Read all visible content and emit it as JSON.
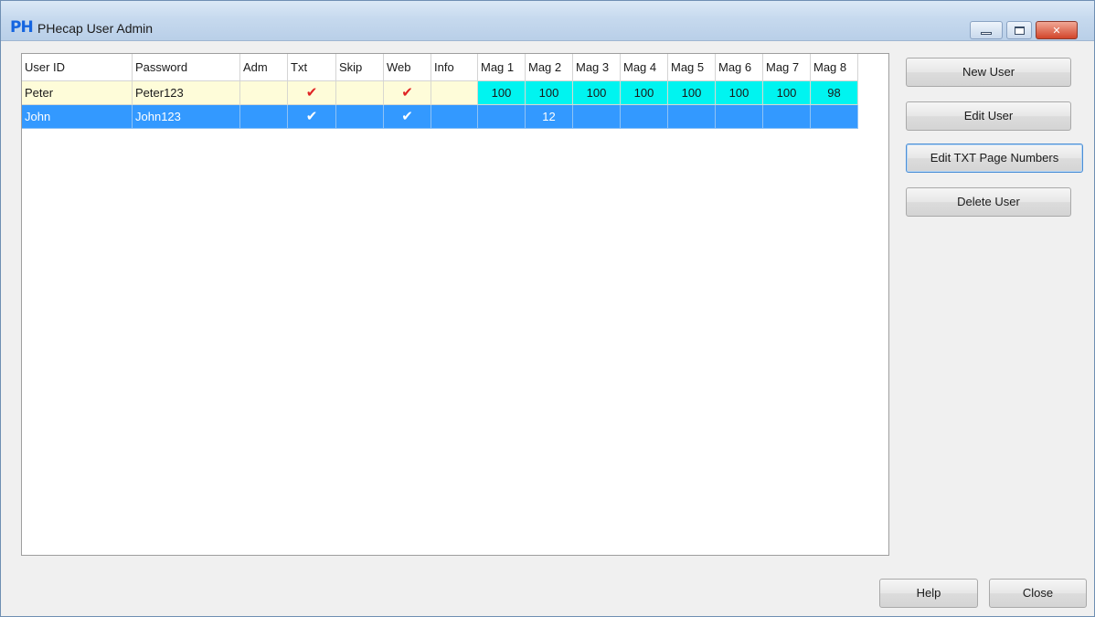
{
  "window": {
    "title": "PHecap User Admin",
    "icon_text": "PH",
    "controls": {
      "minimize": "minimize-icon",
      "maximize": "maximize-icon",
      "close": "close-icon",
      "close_glyph": "✕"
    }
  },
  "table": {
    "columns": [
      "User ID",
      "Password",
      "Adm",
      "Txt",
      "Skip",
      "Web",
      "Info",
      "Mag 1",
      "Mag 2",
      "Mag 3",
      "Mag 4",
      "Mag 5",
      "Mag 6",
      "Mag 7",
      "Mag 8"
    ],
    "check_glyph": "✔",
    "rows": [
      {
        "user_id": "Peter",
        "password": "Peter123",
        "adm": "",
        "txt": "✔",
        "skip": "",
        "web": "✔",
        "info": "",
        "mags": [
          "100",
          "100",
          "100",
          "100",
          "100",
          "100",
          "100",
          "98"
        ]
      },
      {
        "user_id": "John",
        "password": "John123",
        "adm": "",
        "txt": "✔",
        "skip": "",
        "web": "✔",
        "info": "",
        "mags": [
          "",
          "12",
          "",
          "",
          "",
          "",
          "",
          ""
        ]
      }
    ]
  },
  "buttons": {
    "new_user": "New User",
    "edit_user": "Edit User",
    "edit_txt_page_numbers": "Edit TXT Page Numbers",
    "delete_user": "Delete User",
    "help": "Help",
    "close": "Close"
  },
  "colors": {
    "selected_row": "#3399ff",
    "first_row": "#fefcd9",
    "mag_highlight": "#00f4f0",
    "check": "#e02424"
  }
}
